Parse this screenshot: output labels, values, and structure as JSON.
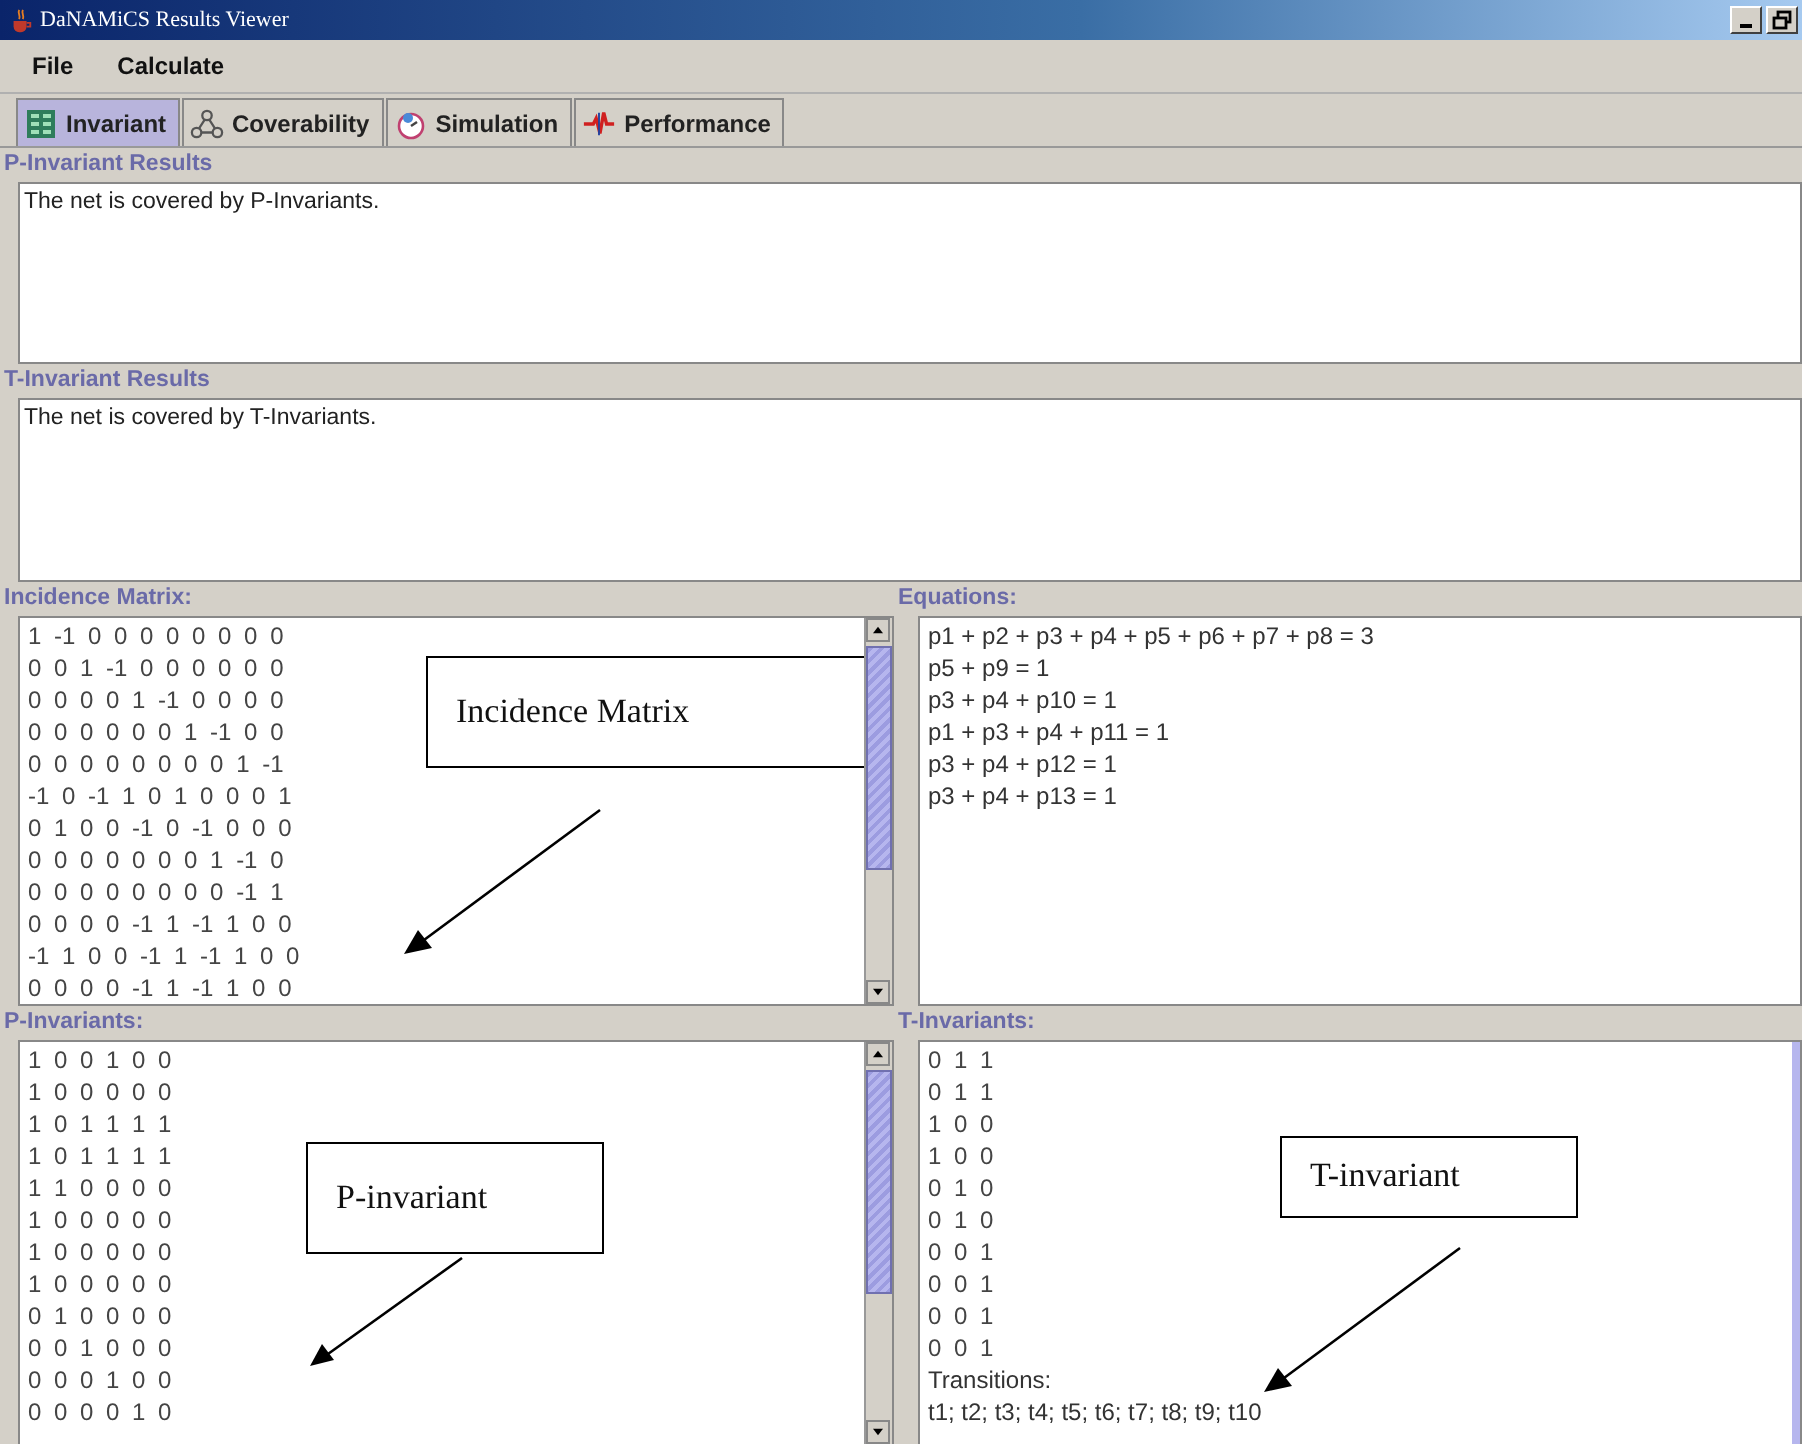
{
  "window": {
    "title": "DaNAMiCS Results Viewer"
  },
  "menu": [
    "File",
    "Calculate"
  ],
  "tabs": [
    {
      "label": "Invariant",
      "selected": true,
      "kind": "grid"
    },
    {
      "label": "Coverability",
      "selected": false,
      "kind": "graph"
    },
    {
      "label": "Simulation",
      "selected": false,
      "kind": "simulation"
    },
    {
      "label": "Performance",
      "selected": false,
      "kind": "performance"
    }
  ],
  "p_invariant_results": {
    "heading": "P-Invariant Results",
    "text": "The net is covered by P-Invariants."
  },
  "t_invariant_results": {
    "heading": "T-Invariant Results",
    "text": "The net is covered by T-Invariants."
  },
  "incidence_matrix": {
    "heading": "Incidence Matrix:",
    "annotation": "Incidence Matrix",
    "rows": [
      "1 -1 0 0 0 0 0 0 0 0",
      "0 0 1 -1 0 0 0 0 0 0",
      "0 0 0 0 1 -1 0 0 0 0",
      "0 0 0 0 0 0 1 -1 0 0",
      "0 0 0 0 0 0 0 0 1 -1",
      "-1 0 -1 1 0 1 0 0 0 1",
      "0 1 0 0 -1 0 -1 0 0 0",
      "0 0 0 0 0 0 0 1 -1 0",
      "0 0 0 0 0 0 0 0 -1 1",
      "0 0 0 0 -1 1 -1 1 0 0",
      "-1 1 0 0 -1 1 -1 1 0 0",
      "0 0 0 0 -1 1 -1 1 0 0"
    ]
  },
  "equations": {
    "heading": "Equations:",
    "lines": [
      "p1 + p2 + p3 + p4 + p5 + p6 + p7 + p8 = 3",
      "p5 + p9 = 1",
      "p3 + p4 + p10 = 1",
      "p1 + p3 + p4 + p11 = 1",
      "p3 + p4 + p12 = 1",
      "p3 + p4 + p13 = 1"
    ]
  },
  "p_invariants": {
    "heading": "P-Invariants:",
    "annotation": "P-invariant",
    "rows": [
      "1 0 0 1 0 0",
      "1 0 0 0 0 0",
      "1 0 1 1 1 1",
      "1 0 1 1 1 1",
      "1 1 0 0 0 0",
      "1 0 0 0 0 0",
      "1 0 0 0 0 0",
      "1 0 0 0 0 0",
      "0 1 0 0 0 0",
      "0 0 1 0 0 0",
      "0 0 0 1 0 0",
      "0 0 0 0 1 0"
    ]
  },
  "t_invariants": {
    "heading": "T-Invariants:",
    "annotation": "T-invariant",
    "rows": [
      "0 1 1",
      "0 1 1",
      "1 0 0",
      "1 0 0",
      "0 1 0",
      "0 1 0",
      "0 0 1",
      "0 0 1",
      "0 0 1",
      "0 0 1"
    ],
    "transitions_label": "Transitions:",
    "transitions": "t1; t2; t3; t4; t5; t6; t7; t8; t9; t10"
  }
}
